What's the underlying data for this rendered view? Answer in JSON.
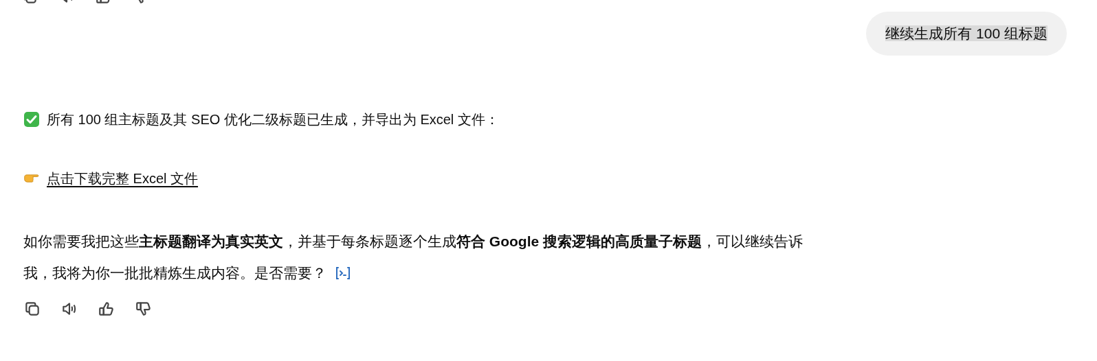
{
  "user_message": {
    "text": "继续生成所有 100 组标题",
    "highlighted": true
  },
  "reply": {
    "status_line": "所有 100 组主标题及其 SEO 优化二级标题已生成，并导出为 Excel 文件：",
    "download_link": "点击下载完整 Excel 文件",
    "paragraph_lines": [
      "如你需要我把这些**主标题翻译为真实英文**，并基于每条标题逐个生成**符合 Google 搜索逻辑的高质量子标题**，可以继续告诉",
      "我，我将为你一批批精炼生成内容。是否需要？"
    ]
  }
}
